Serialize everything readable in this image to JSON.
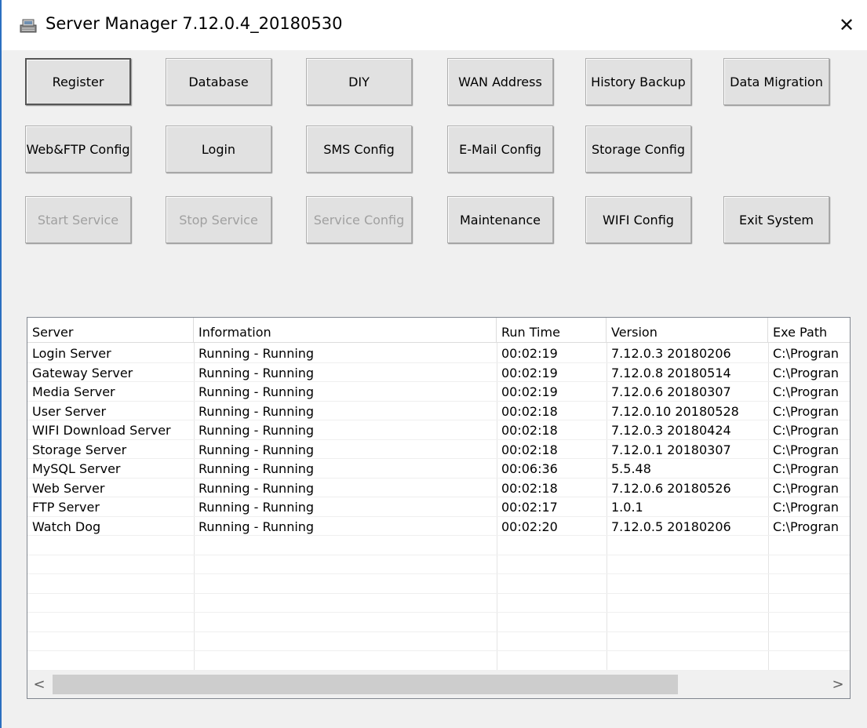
{
  "window": {
    "title": "Server Manager 7.12.0.4_20180530",
    "app_icon": "server-manager-icon",
    "close_icon": "close-icon",
    "close_glyph": "✕"
  },
  "buttons": {
    "row1": [
      {
        "label": "Register",
        "default": true
      },
      {
        "label": "Database"
      },
      {
        "label": "DIY"
      },
      {
        "label": "WAN Address"
      },
      {
        "label": "History Backup"
      },
      {
        "label": "Data Migration"
      }
    ],
    "row2": [
      {
        "label": "Web&FTP Config"
      },
      {
        "label": "Login"
      },
      {
        "label": "SMS Config"
      },
      {
        "label": "E-Mail Config"
      },
      {
        "label": "Storage Config"
      }
    ],
    "row3": [
      {
        "label": "Start Service",
        "disabled": true
      },
      {
        "label": "Stop Service",
        "disabled": true
      },
      {
        "label": "Service Config",
        "disabled": true
      },
      {
        "label": "Maintenance"
      },
      {
        "label": "WIFI Config"
      },
      {
        "label": "Exit System"
      }
    ]
  },
  "table": {
    "columns": [
      "Server",
      "Information",
      "Run Time",
      "Version",
      "Exe Path"
    ],
    "rows": [
      [
        "Login Server",
        "Running - Running",
        "00:02:19",
        "7.12.0.3 20180206",
        "C:\\Progran"
      ],
      [
        "Gateway Server",
        "Running - Running",
        "00:02:19",
        "7.12.0.8 20180514",
        "C:\\Progran"
      ],
      [
        "Media Server",
        "Running - Running",
        "00:02:19",
        "7.12.0.6 20180307",
        "C:\\Progran"
      ],
      [
        "User Server",
        "Running - Running",
        "00:02:18",
        "7.12.0.10 20180528",
        "C:\\Progran"
      ],
      [
        "WIFI Download Server",
        "Running - Running",
        "00:02:18",
        "7.12.0.3 20180424",
        "C:\\Progran"
      ],
      [
        "Storage Server",
        "Running - Running",
        "00:02:18",
        "7.12.0.1 20180307",
        "C:\\Progran"
      ],
      [
        "MySQL Server",
        "Running - Running",
        "00:06:36",
        "5.5.48",
        "C:\\Progran"
      ],
      [
        "Web Server",
        "Running - Running",
        "00:02:18",
        "7.12.0.6  20180526",
        "C:\\Progran"
      ],
      [
        "FTP Server",
        "Running - Running",
        "00:02:17",
        "1.0.1",
        "C:\\Progran"
      ],
      [
        "Watch Dog",
        "Running - Running",
        "00:02:20",
        "7.12.0.5 20180206",
        "C:\\Progran"
      ]
    ],
    "empty_rows": 7,
    "scroll": {
      "left_glyph": "<",
      "right_glyph": ">",
      "thumb_fraction": 0.81
    }
  },
  "colors": {
    "window_bg": "#f0f0f0",
    "button_face": "#e1e1e1",
    "disabled_text": "#a0a0a0",
    "accent_edge": "#2b6fc0"
  }
}
